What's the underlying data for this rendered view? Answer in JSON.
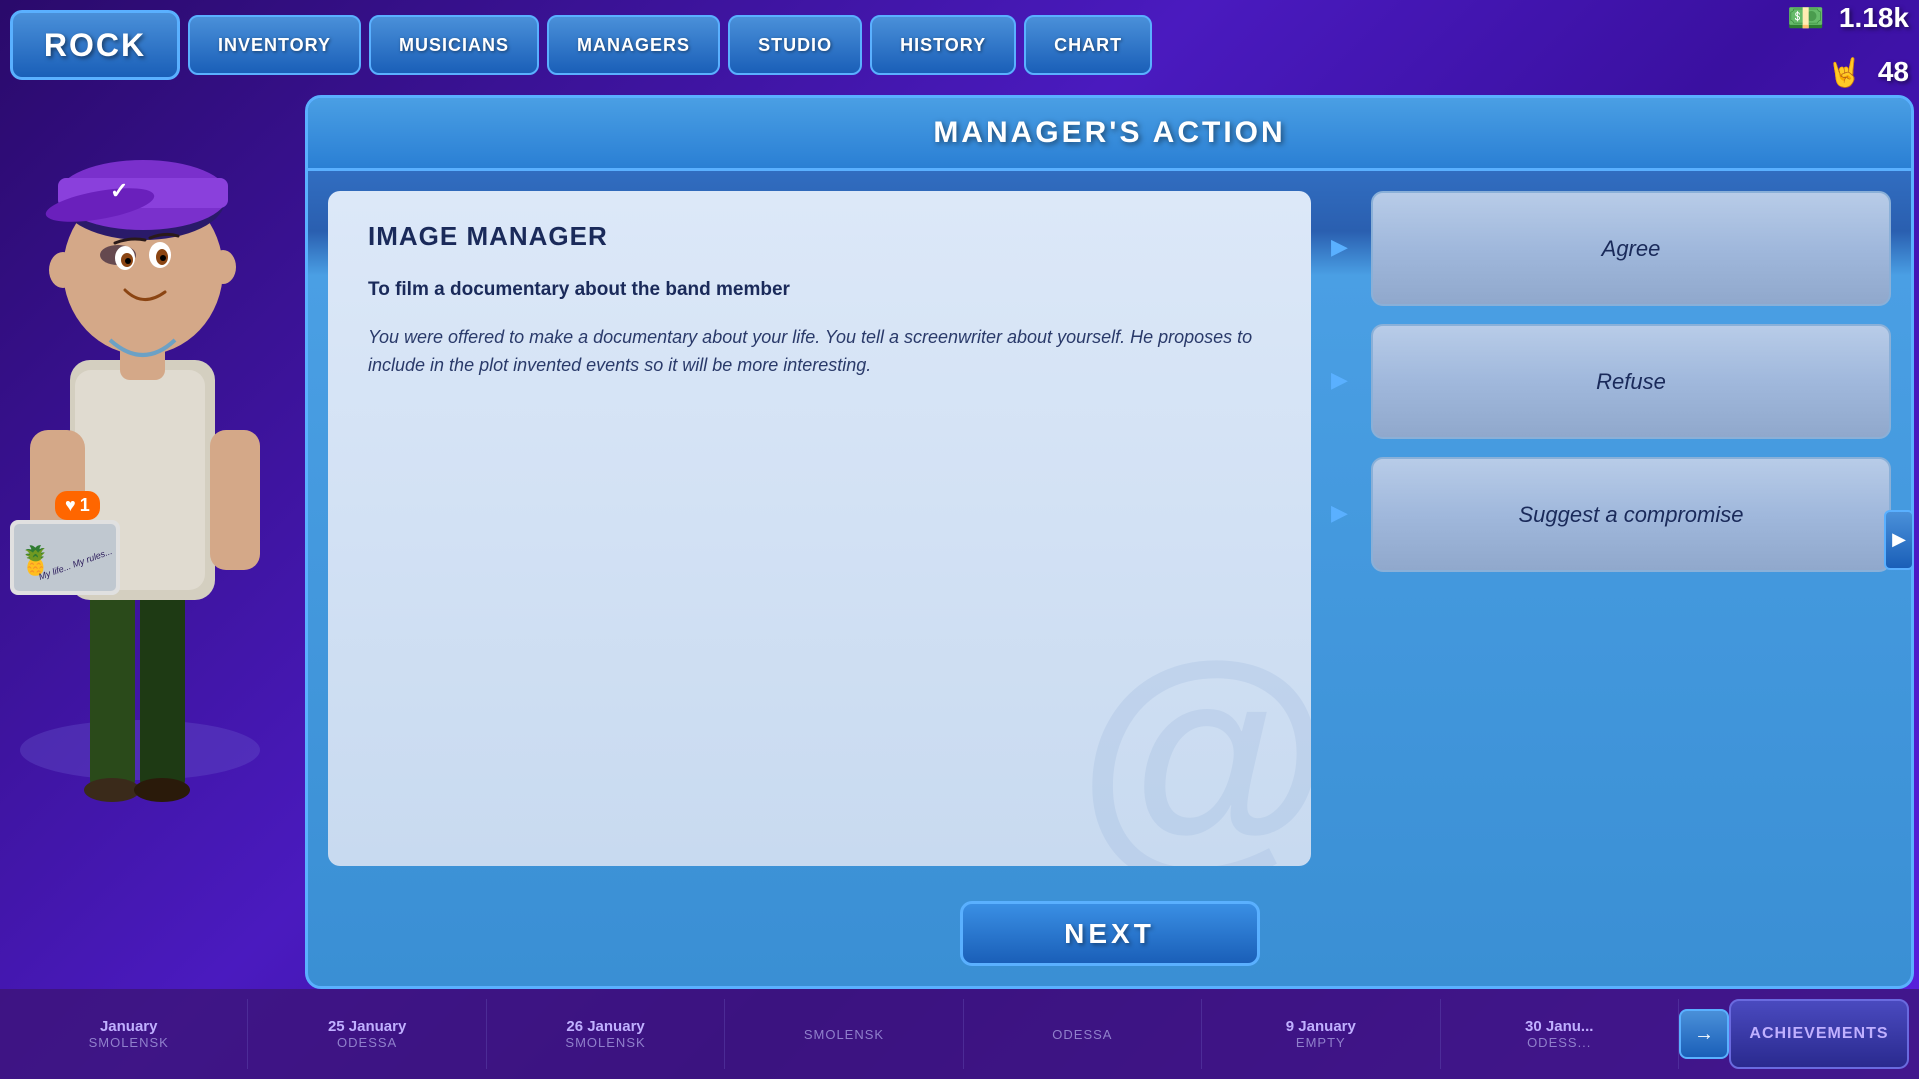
{
  "nav": {
    "logo": "ROCK",
    "buttons": [
      {
        "id": "inventory",
        "label": "INVENTORY"
      },
      {
        "id": "musicians",
        "label": "MUSICIANS"
      },
      {
        "id": "managers",
        "label": "MANAGERS"
      },
      {
        "id": "studio",
        "label": "STUDIO"
      },
      {
        "id": "history",
        "label": "HISTORY"
      },
      {
        "id": "chart",
        "label": "CHART"
      }
    ]
  },
  "currency": {
    "money": "1.18k",
    "fans": "48",
    "money_icon": "💵",
    "fans_icon": "🤘"
  },
  "panel": {
    "title": "MANAGER'S ACTION",
    "content": {
      "subtitle": "IMAGE MANAGER",
      "bold_text": "To film a documentary about the band member",
      "italic_text": "You were offered to make a documentary about your life. You tell a screenwriter about yourself. He proposes to include in the plot invented events so it will be more interesting.",
      "watermark": "@"
    },
    "choices": [
      {
        "id": "agree",
        "label": "Agree"
      },
      {
        "id": "refuse",
        "label": "Refuse"
      },
      {
        "id": "compromise",
        "label": "Suggest a compromise"
      }
    ],
    "next_button": "NEXT"
  },
  "timeline": {
    "items": [
      {
        "date": "January",
        "city": "SMOLENSK"
      },
      {
        "date": "25 January",
        "city": "ODESSA"
      },
      {
        "date": "26 January",
        "city": "SMOLENSK"
      },
      {
        "date": "",
        "city": "SMOLENSK"
      },
      {
        "date": "",
        "city": "ODESSA"
      },
      {
        "date": "9 January",
        "city": "EMPTY"
      },
      {
        "date": "30 Janu...",
        "city": "ODESS..."
      }
    ],
    "achievements_label": "ACHIEVEMENTS"
  },
  "notification": {
    "icon": "♥",
    "count": "1"
  }
}
